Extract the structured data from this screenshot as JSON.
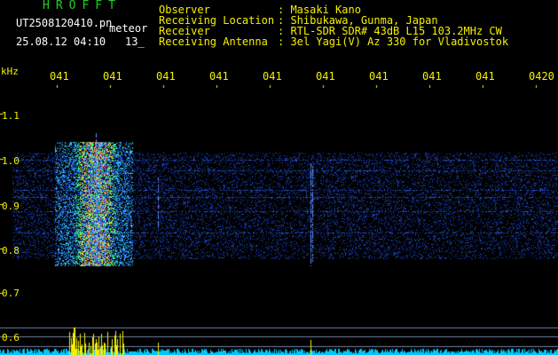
{
  "header": {
    "title": "HROFFT",
    "filename": "UT2508120410.pn",
    "tag": "meteor",
    "datetime": "25.08.12 04:10",
    "count": "13_"
  },
  "info": {
    "rows": [
      {
        "label": "Observer",
        "value": ": Masaki Kano"
      },
      {
        "label": "Receiving Location",
        "value": ": Shibukawa, Gunma, Japan"
      },
      {
        "label": "Receiver",
        "value": ": RTL-SDR SDR# 43dB L15 103.2MHz CW"
      },
      {
        "label": "Receiving Antenna",
        "value": ": 3el Yagi(V) Az 330 for Vladivostok"
      }
    ]
  },
  "colors": {
    "text": "#f5f000",
    "title": "#20d020",
    "background": "#000000",
    "noise": "#1a3cff",
    "baseline": "#00d8ff"
  },
  "chart_data": {
    "type": "heatmap",
    "title": "",
    "ylabel": "kHz",
    "yticks": [
      "1.1",
      "1.0",
      "0.9",
      "0.8",
      "0.7",
      "0.6"
    ],
    "xticks": [
      "041",
      "041",
      "041",
      "041",
      "041",
      "041",
      "041",
      "041",
      "041",
      "0420"
    ],
    "grid": false
  }
}
